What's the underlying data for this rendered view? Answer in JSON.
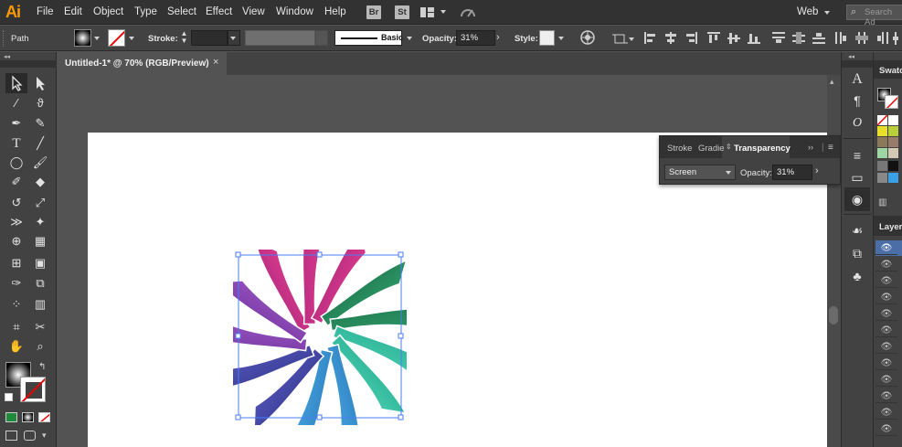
{
  "app": {
    "logo": "Ai"
  },
  "menu": [
    "File",
    "Edit",
    "Object",
    "Type",
    "Select",
    "Effect",
    "View",
    "Window",
    "Help"
  ],
  "badges": {
    "bridge": "Br",
    "stock": "St"
  },
  "workspace": {
    "label": "Web"
  },
  "search": {
    "placeholder": "Search Ad"
  },
  "control": {
    "selection_type": "Path",
    "stroke_label": "Stroke:",
    "brush_definition": "Basic",
    "opacity_label": "Opacity:",
    "opacity_value": "31%",
    "style_label": "Style:"
  },
  "document": {
    "tab_title": "Untitled-1* @ 70% (RGB/Preview)",
    "close": "×"
  },
  "transparency_panel": {
    "tabs": [
      "Stroke",
      "Gradie",
      "Transparency"
    ],
    "active_tab": "Transparency",
    "blend_mode": "Screen",
    "opacity_label": "Opacity:",
    "opacity_value": "31%"
  },
  "right_panels": {
    "swatches_title": "Swatc",
    "layers_title": "Layers"
  },
  "colors": {
    "accent": "#ff9a00",
    "selection": "#4a7df5",
    "petal_magenta": "#d21a76",
    "petal_purple": "#7a2d9a",
    "petal_navy": "#2c2f8e",
    "petal_blue": "#1e86d0",
    "petal_teal": "#23b39a",
    "petal_green": "#197d57"
  }
}
